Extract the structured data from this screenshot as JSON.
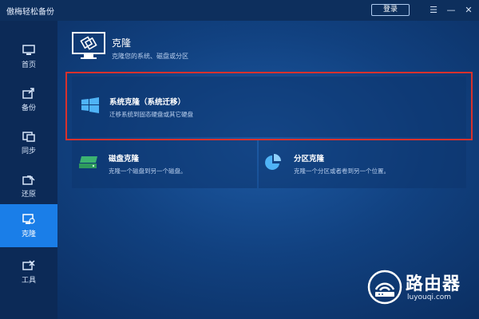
{
  "app": {
    "title": "傲梅轻松备份",
    "login_label": "登录"
  },
  "sidebar": {
    "items": [
      {
        "label": "首页",
        "icon": "home-icon"
      },
      {
        "label": "备份",
        "icon": "backup-icon"
      },
      {
        "label": "同步",
        "icon": "sync-icon"
      },
      {
        "label": "还原",
        "icon": "restore-icon"
      },
      {
        "label": "克隆",
        "icon": "clone-icon",
        "active": true
      },
      {
        "label": "工具",
        "icon": "tools-icon"
      }
    ]
  },
  "header": {
    "title": "克隆",
    "description": "克隆您的系统、磁盘或分区"
  },
  "options": {
    "system": {
      "title": "系统克隆（系统迁移）",
      "description": "迁移系统到固态硬盘或其它硬盘"
    },
    "disk": {
      "title": "磁盘克隆",
      "description": "克隆一个磁盘到另一个磁盘。"
    },
    "partition": {
      "title": "分区克隆",
      "description": "克隆一个分区或者卷到另一个位置。"
    }
  },
  "watermark": {
    "name": "路由器",
    "url": "luyouqi.com"
  },
  "colors": {
    "active": "#1a7ee8",
    "highlight": "#d8312c",
    "disk_icon": "#3cb371",
    "windows_icon": "#4fb3f6"
  }
}
